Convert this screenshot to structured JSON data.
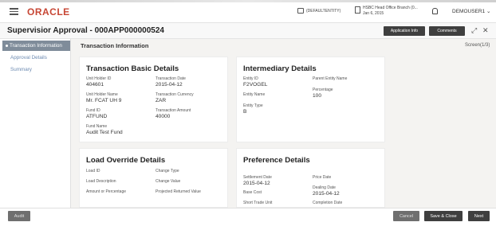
{
  "header": {
    "logo": "ORACLE",
    "entity": "(DEFAULTENTITY)",
    "branch_line1": "HSBC Head Office Branch (0...",
    "branch_line2": "Jan 6, 2015",
    "user": "DEMOUSER1 ⌄"
  },
  "titlebar": {
    "title": "Supervisior Approval - 000APP000000524",
    "application_info": "Application Info",
    "comments": "Comments"
  },
  "sidebar": {
    "items": [
      {
        "label": "Transaction Information"
      },
      {
        "label": "Approval Details"
      },
      {
        "label": "Summary"
      }
    ]
  },
  "main": {
    "section_title": "Transaction Information",
    "screen": "Screen(1/3)",
    "basic": {
      "title": "Transaction Basic Details",
      "unit_holder_id_label": "Unit Holder ID",
      "unit_holder_id": "404601",
      "transaction_date_label": "Transaction Date",
      "transaction_date": "2015-04-12",
      "unit_holder_name_label": "Unit Holder Name",
      "unit_holder_name": "Mr. FCAT UH 9",
      "transaction_currency_label": "Transaction Currency",
      "transaction_currency": "ZAR",
      "fund_id_label": "Fund ID",
      "fund_id": "ATFUND",
      "transaction_amount_label": "Transaction Amount",
      "transaction_amount": "40000",
      "fund_name_label": "Fund Name",
      "fund_name": "Audit Test Fund"
    },
    "intermediary": {
      "title": "Intermediary Details",
      "entity_id_label": "Entity ID",
      "entity_id": "F2VOGEL",
      "parent_entity_name_label": "Parent Entity Name",
      "entity_name_label": "Entity Name",
      "percentage_label": "Percentage",
      "percentage": "100",
      "entity_type_label": "Entity Type",
      "entity_type": "B"
    },
    "load_override": {
      "title": "Load Override Details",
      "load_id_label": "Load ID",
      "change_type_label": "Change Type",
      "load_description_label": "Load Description",
      "change_value_label": "Change Value",
      "amount_or_percentage_label": "Amount or Percentage",
      "projected_returned_value_label": "Projected Returned Value"
    },
    "preference": {
      "title": "Preference Details",
      "settlement_date_label": "Settlement Date",
      "settlement_date": "2015-04-12",
      "price_date_label": "Price Date",
      "dealing_date_label": "Dealing Date",
      "dealing_date": "2015-04-12",
      "base_cost_label": "Base Cost",
      "short_trade_unit_label": "Short Trade Unit",
      "completion_date_label": "Completion Date"
    }
  },
  "footer": {
    "audit": "Audit",
    "cancel": "Cancel",
    "save_close": "Save & Close",
    "next": "Next"
  }
}
